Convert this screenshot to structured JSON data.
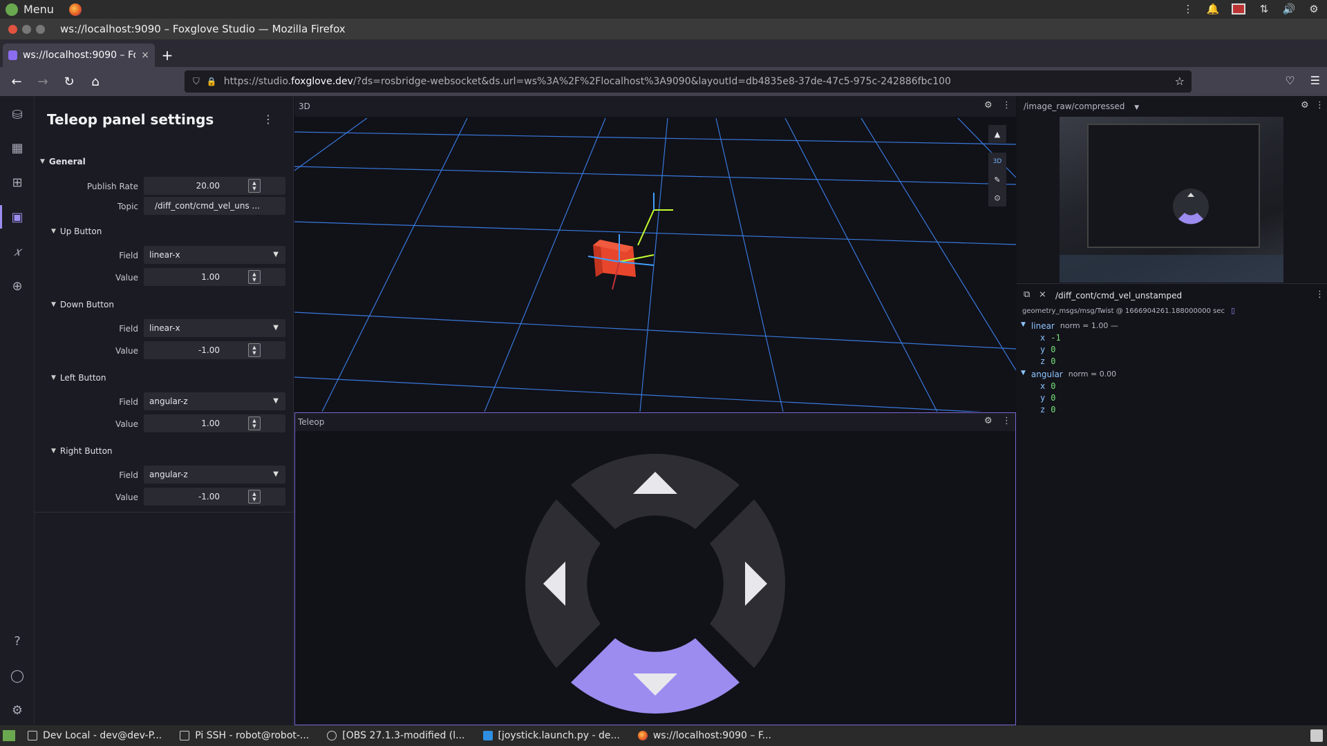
{
  "os_bar": {
    "menu_label": "Menu"
  },
  "window": {
    "title": "ws://localhost:9090 – Foxglove Studio — Mozilla Firefox"
  },
  "browser": {
    "tab_title": "ws://localhost:9090 – Fox",
    "tab_close": "×",
    "new_tab": "+",
    "url_prefix": "https://studio.",
    "url_domain": "foxglove.dev",
    "url_rest": "/?ds=rosbridge-websocket&ds.url=ws%3A%2F%2Flocalhost%3A9090&layoutId=db4835e8-37de-47c5-975c-242886fbc100"
  },
  "settings": {
    "title": "Teleop panel settings",
    "general": {
      "label": "General",
      "publish_rate_label": "Publish Rate",
      "publish_rate": "20.00",
      "topic_label": "Topic",
      "topic": "/diff_cont/cmd_vel_uns ..."
    },
    "up": {
      "label": "Up Button",
      "field_label": "Field",
      "field": "linear-x",
      "value_label": "Value",
      "value": "1.00"
    },
    "down": {
      "label": "Down Button",
      "field_label": "Field",
      "field": "linear-x",
      "value_label": "Value",
      "value": "-1.00"
    },
    "left": {
      "label": "Left Button",
      "field_label": "Field",
      "field": "angular-z",
      "value_label": "Value",
      "value": "1.00"
    },
    "right": {
      "label": "Right Button",
      "field_label": "Field",
      "field": "angular-z",
      "value_label": "Value",
      "value": "-1.00"
    }
  },
  "panel_3d": {
    "title": "3D",
    "tool_3d": "3D"
  },
  "teleop": {
    "title": "Teleop",
    "active_button": "down"
  },
  "image_panel": {
    "topic": "/image_raw/compressed"
  },
  "message_panel": {
    "topic": "/diff_cont/cmd_vel_unstamped",
    "meta": "geometry_msgs/msg/Twist @ 1666904261.188000000 sec",
    "linear": {
      "label": "linear",
      "norm": "norm = 1.00 —",
      "x": "-1",
      "y": "0",
      "z": "0"
    },
    "angular": {
      "label": "angular",
      "norm": "norm = 0.00",
      "x": "0",
      "y": "0",
      "z": "0"
    },
    "key_x": "x",
    "key_y": "y",
    "key_z": "z"
  },
  "taskbar": {
    "items": [
      "Dev Local - dev@dev-P...",
      "Pi SSH - robot@robot-...",
      "[OBS 27.1.3-modified (l...",
      "[joystick.launch.py - de...",
      "ws://localhost:9090 – F..."
    ]
  },
  "colors": {
    "accent": "#9c8cf0",
    "grid": "#3f8cff",
    "key": "#8ec5ff",
    "number": "#79e37b"
  }
}
